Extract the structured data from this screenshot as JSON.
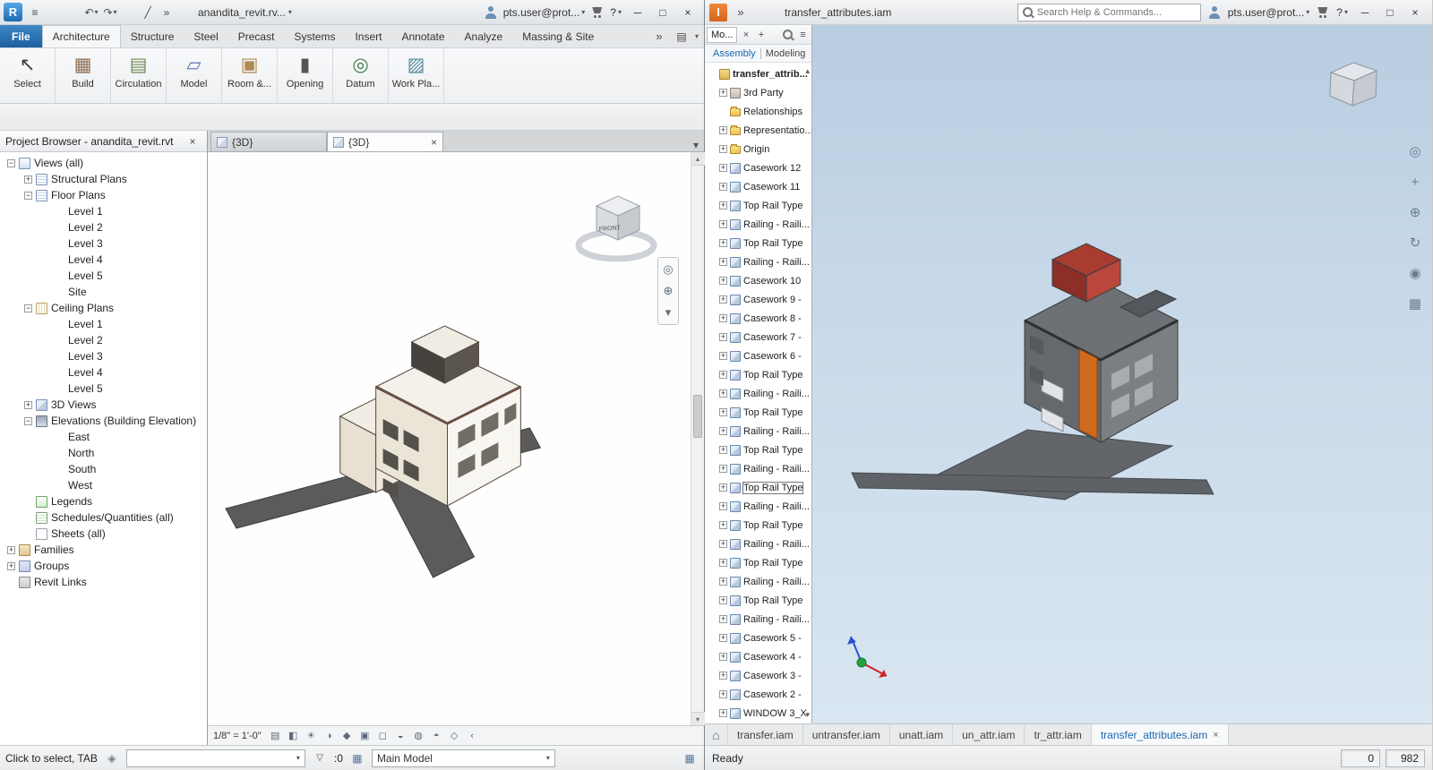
{
  "window_buttons": [
    {
      "name": "minimize-button",
      "glyph": "─"
    },
    {
      "name": "maximize-button",
      "glyph": "□"
    },
    {
      "name": "close-button",
      "glyph": "×"
    }
  ],
  "revit": {
    "titlebar": {
      "logo_letter": "R",
      "filename": "anandita_revit.rv...",
      "account": "pts.user@prot...",
      "help": "?",
      "qat": [
        {
          "name": "menu-icon",
          "glyph": "≡"
        },
        {
          "name": "open-icon",
          "glyph": "",
          "icon": "open"
        },
        {
          "name": "save-icon",
          "glyph": "",
          "icon": "save"
        },
        {
          "name": "undo-icon",
          "glyph": "↶",
          "dropdown": true
        },
        {
          "name": "redo-icon",
          "glyph": "↷",
          "dropdown": true
        },
        {
          "name": "print-icon",
          "glyph": "",
          "icon": "print"
        },
        {
          "name": "measure-icon",
          "glyph": "╱"
        },
        {
          "name": "qat-overflow-icon",
          "glyph": "»"
        }
      ]
    },
    "ribbon_tabs": [
      {
        "label": "File",
        "file": true
      },
      {
        "label": "Architecture",
        "active": true
      },
      {
        "label": "Structure"
      },
      {
        "label": "Steel"
      },
      {
        "label": "Precast"
      },
      {
        "label": "Systems"
      },
      {
        "label": "Insert"
      },
      {
        "label": "Annotate"
      },
      {
        "label": "Analyze"
      },
      {
        "label": "Massing & Site"
      }
    ],
    "ribbon_panels": [
      {
        "label": "Select",
        "icon": "select",
        "glyph": "↖",
        "name": "select-panel-button"
      },
      {
        "label": "Build",
        "icon": "build",
        "glyph": "▦",
        "name": "build-panel-button"
      },
      {
        "label": "Circulation",
        "icon": "circulation",
        "glyph": "▤",
        "name": "circulation-panel-button"
      },
      {
        "label": "Model",
        "icon": "model",
        "glyph": "▱",
        "name": "model-panel-button"
      },
      {
        "label": "Room &...",
        "icon": "room",
        "glyph": "▣",
        "name": "room-area-panel-button"
      },
      {
        "label": "Opening",
        "icon": "opening",
        "glyph": "▮",
        "name": "opening-panel-button"
      },
      {
        "label": "Datum",
        "icon": "datum",
        "glyph": "◎",
        "name": "datum-panel-button"
      },
      {
        "label": "Work Pla...",
        "icon": "workplane",
        "glyph": "▨",
        "name": "work-plane-panel-button"
      }
    ],
    "project_browser": {
      "title": "Project Browser - anandita_revit.rvt",
      "tree": [
        {
          "label": "Views (all)",
          "indent": 0,
          "exp": "minus",
          "icon": "views"
        },
        {
          "label": "Structural Plans",
          "indent": 1,
          "exp": "plus",
          "icon": "plan"
        },
        {
          "label": "Floor Plans",
          "indent": 1,
          "exp": "minus",
          "icon": "plan"
        },
        {
          "label": "Level 1",
          "indent": 2,
          "icon": "none"
        },
        {
          "label": "Level 2",
          "indent": 2,
          "icon": "none"
        },
        {
          "label": "Level 3",
          "indent": 2,
          "icon": "none"
        },
        {
          "label": "Level 4",
          "indent": 2,
          "icon": "none"
        },
        {
          "label": "Level 5",
          "indent": 2,
          "icon": "none"
        },
        {
          "label": "Site",
          "indent": 2,
          "icon": "none"
        },
        {
          "label": "Ceiling Plans",
          "indent": 1,
          "exp": "minus",
          "icon": "ceiling"
        },
        {
          "label": "Level 1",
          "indent": 2,
          "icon": "none"
        },
        {
          "label": "Level 2",
          "indent": 2,
          "icon": "none"
        },
        {
          "label": "Level 3",
          "indent": 2,
          "icon": "none"
        },
        {
          "label": "Level 4",
          "indent": 2,
          "icon": "none"
        },
        {
          "label": "Level 5",
          "indent": 2,
          "icon": "none"
        },
        {
          "label": "3D Views",
          "indent": 1,
          "exp": "plus",
          "icon": "threed"
        },
        {
          "label": "Elevations (Building Elevation)",
          "indent": 1,
          "exp": "minus",
          "icon": "elev"
        },
        {
          "label": "East",
          "indent": 2,
          "icon": "none"
        },
        {
          "label": "North",
          "indent": 2,
          "icon": "none"
        },
        {
          "label": "South",
          "indent": 2,
          "icon": "none"
        },
        {
          "label": "West",
          "indent": 2,
          "icon": "none"
        },
        {
          "label": "Legends",
          "indent": 1,
          "icon": "legend"
        },
        {
          "label": "Schedules/Quantities (all)",
          "indent": 1,
          "icon": "schedule"
        },
        {
          "label": "Sheets (all)",
          "indent": 1,
          "icon": "sheet"
        },
        {
          "label": "Families",
          "indent": 0,
          "exp": "plus",
          "icon": "family"
        },
        {
          "label": "Groups",
          "indent": 0,
          "exp": "plus",
          "icon": "group"
        },
        {
          "label": "Revit Links",
          "indent": 0,
          "icon": "link"
        }
      ]
    },
    "view_tabs": [
      {
        "label": "{3D}"
      },
      {
        "label": "{3D}",
        "active": true
      }
    ],
    "view_bar": {
      "scale": "1/8\" = 1'-0\"",
      "icons": [
        {
          "name": "detail-level-icon",
          "glyph": "▤"
        },
        {
          "name": "visual-style-icon",
          "glyph": "◧"
        },
        {
          "name": "sun-path-icon",
          "glyph": "☀"
        },
        {
          "name": "shadows-icon",
          "glyph": "◑"
        },
        {
          "name": "show-rendering-icon",
          "glyph": "◆"
        },
        {
          "name": "crop-view-icon",
          "glyph": "▣"
        },
        {
          "name": "show-crop-icon",
          "glyph": "◻"
        },
        {
          "name": "temporary-hide-icon",
          "glyph": "◒"
        },
        {
          "name": "reveal-hidden-icon",
          "glyph": "◍"
        },
        {
          "name": "temporary-view-properties-icon",
          "glyph": "◓"
        },
        {
          "name": "show-constraints-icon",
          "glyph": "◇"
        },
        {
          "name": "scroll-left-icon",
          "glyph": "‹"
        }
      ]
    },
    "nav_icons": [
      {
        "name": "steering-wheel-icon",
        "glyph": "◎"
      },
      {
        "name": "zoom-icon",
        "glyph": "⊕"
      },
      {
        "name": "nav-options-icon",
        "glyph": "▾"
      }
    ],
    "viewcube": {
      "front": "FRONT"
    },
    "statusbar": {
      "hint": "Click to select, TAB",
      "workset_count": ":0",
      "design_option": "Main Model"
    }
  },
  "inventor": {
    "titlebar": {
      "logo_letter": "I",
      "title": "transfer_attributes.iam",
      "search_placeholder": "Search Help & Commands...",
      "account": "pts.user@prot...",
      "help": "?"
    },
    "browser": {
      "panel_tab": "Mo...",
      "subtabs": [
        {
          "label": "Assembly",
          "active": true
        },
        {
          "label": "Modeling"
        }
      ],
      "tree": [
        {
          "label": "transfer_attrib...",
          "indent": 0,
          "icon": "assembly",
          "bold": true
        },
        {
          "label": "3rd Party",
          "indent": 1,
          "exp": "plus",
          "icon": "thirdparty"
        },
        {
          "label": "Relationships",
          "indent": 1,
          "icon": "folder"
        },
        {
          "label": "Representatio...",
          "indent": 1,
          "exp": "plus",
          "icon": "folder"
        },
        {
          "label": "Origin",
          "indent": 1,
          "exp": "plus",
          "icon": "folder"
        },
        {
          "label": "Casework 12",
          "indent": 1,
          "exp": "plus",
          "icon": "part"
        },
        {
          "label": "Casework 11",
          "indent": 1,
          "exp": "plus",
          "icon": "part"
        },
        {
          "label": "Top Rail Type",
          "indent": 1,
          "exp": "plus",
          "icon": "part"
        },
        {
          "label": "Railing - Raili...",
          "indent": 1,
          "exp": "plus",
          "icon": "part"
        },
        {
          "label": "Top Rail Type",
          "indent": 1,
          "exp": "plus",
          "icon": "part"
        },
        {
          "label": "Railing - Raili...",
          "indent": 1,
          "exp": "plus",
          "icon": "part"
        },
        {
          "label": "Casework 10",
          "indent": 1,
          "exp": "plus",
          "icon": "part"
        },
        {
          "label": "Casework 9 -",
          "indent": 1,
          "exp": "plus",
          "icon": "part"
        },
        {
          "label": "Casework 8 -",
          "indent": 1,
          "exp": "plus",
          "icon": "part"
        },
        {
          "label": "Casework 7 -",
          "indent": 1,
          "exp": "plus",
          "icon": "part"
        },
        {
          "label": "Casework 6 -",
          "indent": 1,
          "exp": "plus",
          "icon": "part"
        },
        {
          "label": "Top Rail Type",
          "indent": 1,
          "exp": "plus",
          "icon": "part"
        },
        {
          "label": "Railing - Raili...",
          "indent": 1,
          "exp": "plus",
          "icon": "part"
        },
        {
          "label": "Top Rail Type",
          "indent": 1,
          "exp": "plus",
          "icon": "part"
        },
        {
          "label": "Railing - Raili...",
          "indent": 1,
          "exp": "plus",
          "icon": "part"
        },
        {
          "label": "Top Rail Type",
          "indent": 1,
          "exp": "plus",
          "icon": "part"
        },
        {
          "label": "Railing - Raili...",
          "indent": 1,
          "exp": "plus",
          "icon": "part"
        },
        {
          "label": "Top Rail Type",
          "indent": 1,
          "exp": "plus",
          "icon": "part",
          "selected": true
        },
        {
          "label": "Railing - Raili...",
          "indent": 1,
          "exp": "plus",
          "icon": "part"
        },
        {
          "label": "Top Rail Type",
          "indent": 1,
          "exp": "plus",
          "icon": "part"
        },
        {
          "label": "Railing - Raili...",
          "indent": 1,
          "exp": "plus",
          "icon": "part"
        },
        {
          "label": "Top Rail Type",
          "indent": 1,
          "exp": "plus",
          "icon": "part"
        },
        {
          "label": "Railing - Raili...",
          "indent": 1,
          "exp": "plus",
          "icon": "part"
        },
        {
          "label": "Top Rail Type",
          "indent": 1,
          "exp": "plus",
          "icon": "part"
        },
        {
          "label": "Railing - Raili...",
          "indent": 1,
          "exp": "plus",
          "icon": "part"
        },
        {
          "label": "Casework 5 -",
          "indent": 1,
          "exp": "plus",
          "icon": "part"
        },
        {
          "label": "Casework 4 -",
          "indent": 1,
          "exp": "plus",
          "icon": "part"
        },
        {
          "label": "Casework 3 -",
          "indent": 1,
          "exp": "plus",
          "icon": "part"
        },
        {
          "label": "Casework 2 -",
          "indent": 1,
          "exp": "plus",
          "icon": "part"
        },
        {
          "label": "WINDOW 3_X",
          "indent": 1,
          "exp": "plus",
          "icon": "part"
        }
      ]
    },
    "nav_icons": [
      {
        "name": "navigation-wheel-icon",
        "glyph": "◎"
      },
      {
        "name": "pan-icon",
        "glyph": "+"
      },
      {
        "name": "zoom-icon",
        "glyph": "⊕"
      },
      {
        "name": "orbit-icon",
        "glyph": "↻"
      },
      {
        "name": "look-at-icon",
        "glyph": "◉"
      },
      {
        "name": "view-face-icon",
        "glyph": "▦"
      }
    ],
    "doc_tabs": [
      {
        "label": "transfer.iam"
      },
      {
        "label": "untransfer.iam"
      },
      {
        "label": "unatt.iam"
      },
      {
        "label": "un_attr.iam"
      },
      {
        "label": "tr_attr.iam"
      },
      {
        "label": "transfer_attributes.iam",
        "active": true
      }
    ],
    "statusbar": {
      "status": "Ready",
      "field1": "0",
      "field2": "982"
    }
  }
}
